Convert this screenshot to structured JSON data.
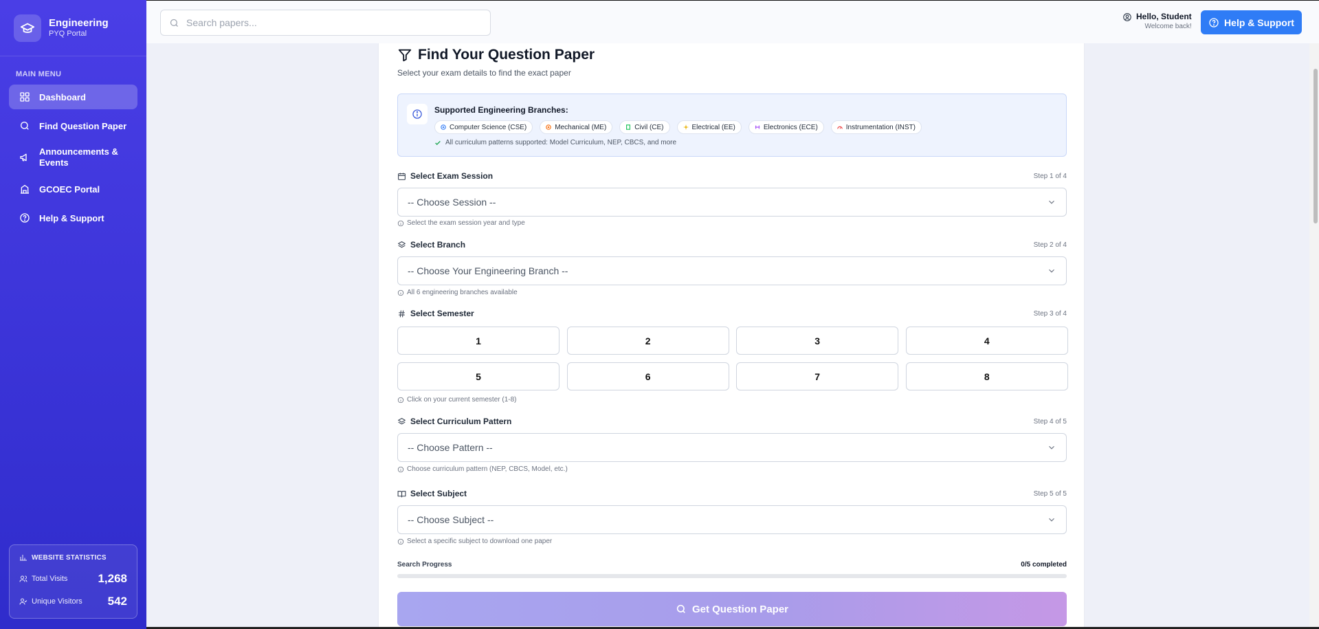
{
  "brand": {
    "title": "Engineering",
    "subtitle": "PYQ Portal",
    "icon": "graduation-cap-icon"
  },
  "sidebar": {
    "menu_heading": "MAIN MENU",
    "items": [
      {
        "label": "Dashboard",
        "icon": "grid-icon",
        "active": true
      },
      {
        "label": "Find Question Paper",
        "icon": "search-icon"
      },
      {
        "label": "Announcements & Events",
        "icon": "megaphone-icon"
      },
      {
        "label": "GCOEC Portal",
        "icon": "building-icon"
      },
      {
        "label": "Help & Support",
        "icon": "help-circle-icon"
      }
    ],
    "stats": {
      "title": "WEBSITE STATISTICS",
      "total_visits_label": "Total Visits",
      "total_visits": "1,268",
      "unique_visitors_label": "Unique Visitors",
      "unique_visitors": "542"
    }
  },
  "header": {
    "search_placeholder": "Search papers...",
    "greeting": "Hello, Student",
    "welcome": "Welcome back!",
    "help_button": "Help & Support"
  },
  "finder": {
    "title": "Find Your Question Paper",
    "subtitle": "Select your exam details to find the exact paper",
    "info": {
      "title": "Supported Engineering Branches:",
      "branches": [
        {
          "label": "Computer Science (CSE)",
          "color": "#3b82f6"
        },
        {
          "label": "Mechanical (ME)",
          "color": "#f97316"
        },
        {
          "label": "Civil (CE)",
          "color": "#22c55e"
        },
        {
          "label": "Electrical (EE)",
          "color": "#eab308"
        },
        {
          "label": "Electronics (ECE)",
          "color": "#a855f7"
        },
        {
          "label": "Instrumentation (INST)",
          "color": "#ef4444"
        }
      ],
      "note": "All curriculum patterns supported: Model Curriculum, NEP, CBCS, and more"
    },
    "session": {
      "label": "Select Exam Session",
      "step": "Step 1 of 4",
      "placeholder": "-- Choose Session --",
      "hint": "Select the exam session year and type"
    },
    "branch": {
      "label": "Select Branch",
      "step": "Step 2 of 4",
      "placeholder": "-- Choose Your Engineering Branch --",
      "hint": "All 6 engineering branches available"
    },
    "semester": {
      "label": "Select Semester",
      "step": "Step 3 of 4",
      "options": [
        "1",
        "2",
        "3",
        "4",
        "5",
        "6",
        "7",
        "8"
      ],
      "hint": "Click on your current semester (1-8)"
    },
    "pattern": {
      "label": "Select Curriculum Pattern",
      "step": "Step 4 of 5",
      "placeholder": "-- Choose Pattern --",
      "hint": "Choose curriculum pattern (NEP, CBCS, Model, etc.)"
    },
    "subject": {
      "label": "Select Subject",
      "step": "Step 5 of 5",
      "placeholder": "-- Choose Subject --",
      "hint": "Select a specific subject to download one paper"
    },
    "progress": {
      "label": "Search Progress",
      "count": "0/5 completed",
      "completed": 0,
      "total": 5
    },
    "submit_label": "Get Question Paper"
  },
  "colors": {
    "sidebar": "#3b34d8",
    "accent": "#2f7cf6",
    "submit_gradient_start": "#a8a6f0",
    "submit_gradient_end": "#c598e6"
  }
}
